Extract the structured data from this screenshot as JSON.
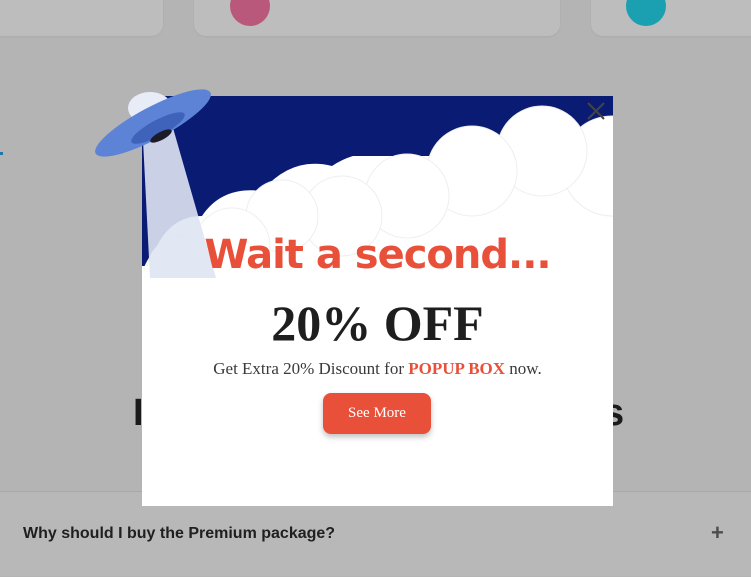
{
  "colors": {
    "accent": "#e8503a",
    "sky": "#0a1b73",
    "overlay": "#b4b4b4"
  },
  "background": {
    "heading_left_fragment": "I",
    "heading_right_fragment": "s",
    "faq": {
      "question": "Why should I buy the Premium package?",
      "toggle_icon": "+"
    }
  },
  "popup": {
    "headline": "Wait a second...",
    "discount": "20% OFF",
    "subtext_before": "Get Extra 20% Discount for ",
    "subtext_brand": "POPUP BOX",
    "subtext_after": " now.",
    "button_label": "See More",
    "close_icon": "close-icon"
  }
}
